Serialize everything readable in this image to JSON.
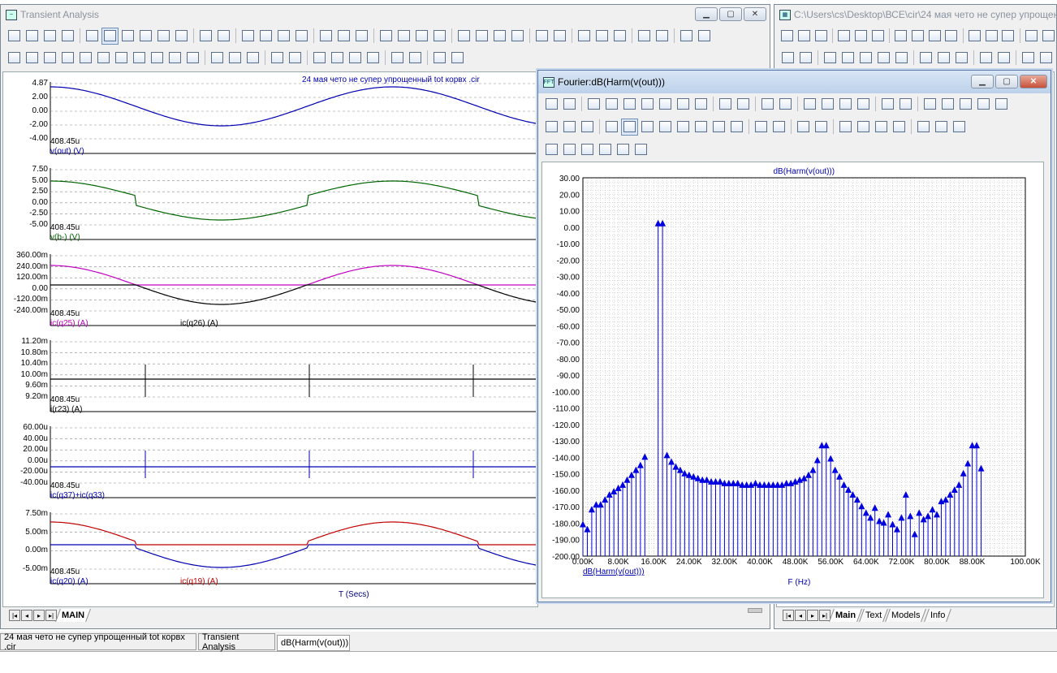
{
  "left_window": {
    "title": "Transient Analysis",
    "circuit_caption": "24 мая чето не супер упрощенный tot корвх .cir",
    "x_axis_label": "T (Secs)",
    "page_tab": "MAIN",
    "panels": [
      {
        "y_labels": [
          "4.87",
          "2.00",
          "0.00",
          "-2.00",
          "-4.00"
        ],
        "x_start": "408.45u",
        "traces": [
          {
            "label": "v(out) (V)",
            "color": "#0000b0"
          }
        ]
      },
      {
        "y_labels": [
          "7.50",
          "5.00",
          "2.50",
          "0.00",
          "-2.50",
          "-5.00"
        ],
        "x_start": "408.45u",
        "traces": [
          {
            "label": "v(b-) (V)",
            "color": "#006400"
          }
        ]
      },
      {
        "y_labels": [
          "360.00m",
          "240.00m",
          "120.00m",
          "0.00",
          "-120.00m",
          "-240.00m"
        ],
        "x_start": "408.45u",
        "traces": [
          {
            "label": "ic(q25) (A)",
            "color": "#c000c0"
          },
          {
            "label": "ic(q26) (A)",
            "color": "#000000"
          }
        ]
      },
      {
        "y_labels": [
          "11.20m",
          "10.80m",
          "10.40m",
          "10.00m",
          "9.60m",
          "9.20m"
        ],
        "x_start": "408.45u",
        "traces": [
          {
            "label": "i(r23) (A)",
            "color": "#000000"
          }
        ]
      },
      {
        "y_labels": [
          "60.00u",
          "40.00u",
          "20.00u",
          "0.00u",
          "-20.00u",
          "-40.00u"
        ],
        "x_start": "408.45u",
        "traces": [
          {
            "label": "ic(q37)+ic(q33)",
            "color": "#0000b0"
          }
        ]
      },
      {
        "y_labels": [
          "7.50m",
          "5.00m",
          "0.00m",
          "-5.00m"
        ],
        "x_start": "408.45u",
        "traces": [
          {
            "label": "ic(q20) (A)",
            "color": "#0000b0"
          },
          {
            "label": "ic(q19) (A)",
            "color": "#c00000"
          }
        ]
      }
    ]
  },
  "right_window": {
    "title": "C:\\Users\\cs\\Desktop\\ВСЕ\\cir\\24 мая чето не супер упрощен",
    "tabs": [
      "Main",
      "Text",
      "Models",
      "Info"
    ]
  },
  "fourier_window": {
    "title": "Fourier:dB(Harm(v(out)))",
    "chart_data": {
      "type": "bar",
      "title": "dB(Harm(v(out)))",
      "xlabel": "F (Hz)",
      "ylabel": "",
      "legend": "dB(Harm(v(out)))",
      "ylim": [
        -200,
        30
      ],
      "xlim": [
        0,
        100000
      ],
      "y_ticks": [
        "30.00",
        "20.00",
        "10.00",
        "0.00",
        "-10.00",
        "-20.00",
        "-30.00",
        "-40.00",
        "-50.00",
        "-60.00",
        "-70.00",
        "-80.00",
        "-90.00",
        "-100.00",
        "-110.00",
        "-120.00",
        "-130.00",
        "-140.00",
        "-150.00",
        "-160.00",
        "-170.00",
        "-180.00",
        "-190.00",
        "-200.00"
      ],
      "x_ticks": [
        "0.00K",
        "8.00K",
        "16.00K",
        "24.00K",
        "32.00K",
        "40.00K",
        "48.00K",
        "56.00K",
        "64.00K",
        "72.00K",
        "80.00K",
        "88.00K",
        "100.00K"
      ],
      "x_tick_values": [
        0,
        8000,
        16000,
        24000,
        32000,
        40000,
        48000,
        56000,
        64000,
        72000,
        80000,
        88000,
        100000
      ],
      "series": [
        {
          "color": "#0000e0",
          "x_step": 1000,
          "values": [
            -181,
            -184,
            -172,
            -169,
            -169,
            -166,
            -163,
            -161,
            -159,
            -157,
            -154,
            -151,
            -148,
            -145,
            -140,
            2,
            2,
            -139,
            -143,
            -146,
            -148,
            -150,
            -151,
            -152,
            -153,
            -154,
            -154,
            -155,
            -155,
            -155,
            -156,
            -156,
            -156,
            -156,
            -157,
            -157,
            -157,
            -156,
            -157,
            -157,
            -157,
            -157,
            -157,
            -157,
            -156,
            -156,
            -155,
            -154,
            -153,
            -151,
            -148,
            -142,
            -133,
            -133,
            -141,
            -148,
            -152,
            -157,
            -160,
            -163,
            -166,
            -170,
            -174,
            -177,
            -171,
            -179,
            -180,
            -175,
            -181,
            -184,
            -177,
            -163,
            -176,
            -187,
            -174,
            -178,
            -176,
            -172,
            -175,
            -167,
            -166,
            -163,
            -160,
            -157,
            -150,
            -144,
            -133,
            -133,
            -147
          ]
        }
      ]
    }
  },
  "bottom_tabs": [
    "24 мая чето не супер упрощенный tot корвх .cir",
    "Transient Analysis",
    "dB(Harm(v(out)))"
  ]
}
